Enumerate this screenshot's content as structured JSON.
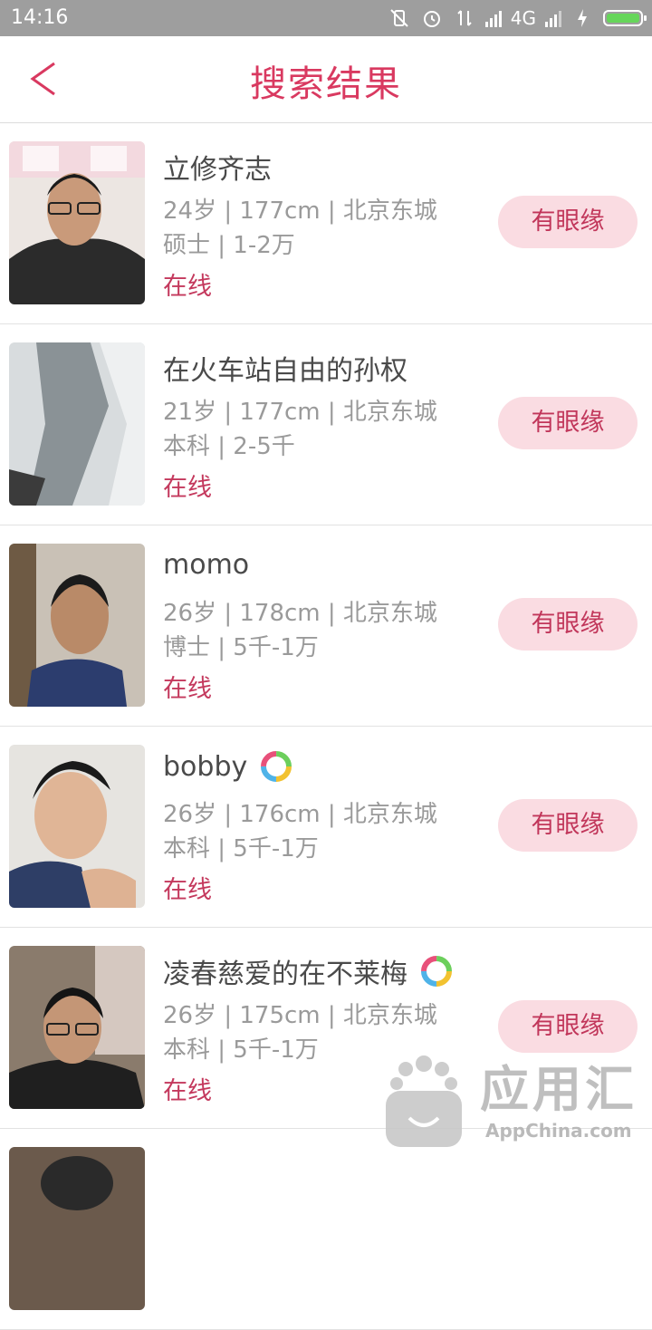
{
  "status_bar": {
    "time": "14:16",
    "network": "4G"
  },
  "header": {
    "back_glyph": "<",
    "title": "搜索结果"
  },
  "list": [
    {
      "name": "立修齐志",
      "meta1": "24岁 | 177cm | 北京东城",
      "meta2": "硕士 | 1-2万",
      "status": "在线",
      "action": "有眼缘",
      "vip": false
    },
    {
      "name": "在火车站自由的孙权",
      "meta1": "21岁 | 177cm | 北京东城",
      "meta2": "本科 | 2-5千",
      "status": "在线",
      "action": "有眼缘",
      "vip": false
    },
    {
      "name": "momo",
      "meta1": "26岁 | 178cm | 北京东城",
      "meta2": "博士 | 5千-1万",
      "status": "在线",
      "action": "有眼缘",
      "vip": false
    },
    {
      "name": "bobby",
      "meta1": "26岁 | 176cm | 北京东城",
      "meta2": "本科 | 5千-1万",
      "status": "在线",
      "action": "有眼缘",
      "vip": true
    },
    {
      "name": "凌春慈爱的在不莱梅",
      "meta1": "26岁 | 175cm | 北京东城",
      "meta2": "本科 | 5千-1万",
      "status": "在线",
      "action": "有眼缘",
      "vip": true
    },
    {
      "name": "",
      "meta1": "",
      "meta2": "",
      "status": "",
      "action": "",
      "vip": false
    }
  ],
  "watermark": {
    "logo": "应用汇",
    "sub": "AppChina.com"
  },
  "colors": {
    "accent": "#d93960",
    "button_bg": "#fadce2",
    "status_bar": "#9e9e9e"
  }
}
